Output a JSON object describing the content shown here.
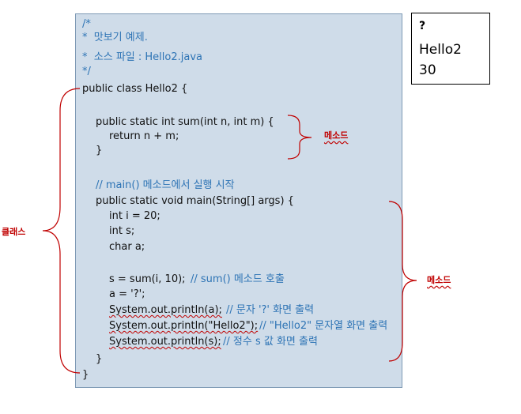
{
  "code": {
    "lines": [
      "/*",
      "*  맛보기 예제.",
      "*  소스 파일 : Hello2.java",
      "*/",
      "public class Hello2 {",
      "public static int sum(int n, int m) {",
      "return n + m;",
      "}",
      "// main() 메소드에서 실행 시작",
      "public static void main(String[] args) {",
      "int i = 20;",
      "int s;",
      "char a;",
      "s = sum(i, 10);",
      "// sum() 메소드 호출",
      "a = '?';",
      "System.out.println(a);",
      "// 문자 '?' 화면 출력",
      "System.out.println(\"Hello2\");",
      "// \"Hello2\" 문자열 화면 출력",
      "System.out.println(s);",
      "// 정수 s 값 화면 출력",
      "}",
      "}"
    ]
  },
  "output": {
    "lines": [
      "?",
      "Hello2",
      "30"
    ]
  },
  "labels": {
    "class_label": "클래스",
    "method_label_sum": "메소드",
    "method_label_main": "메소드"
  },
  "colors": {
    "code_background": "#cfdce9",
    "comment": "#2e74b5",
    "label": "#c00000"
  }
}
